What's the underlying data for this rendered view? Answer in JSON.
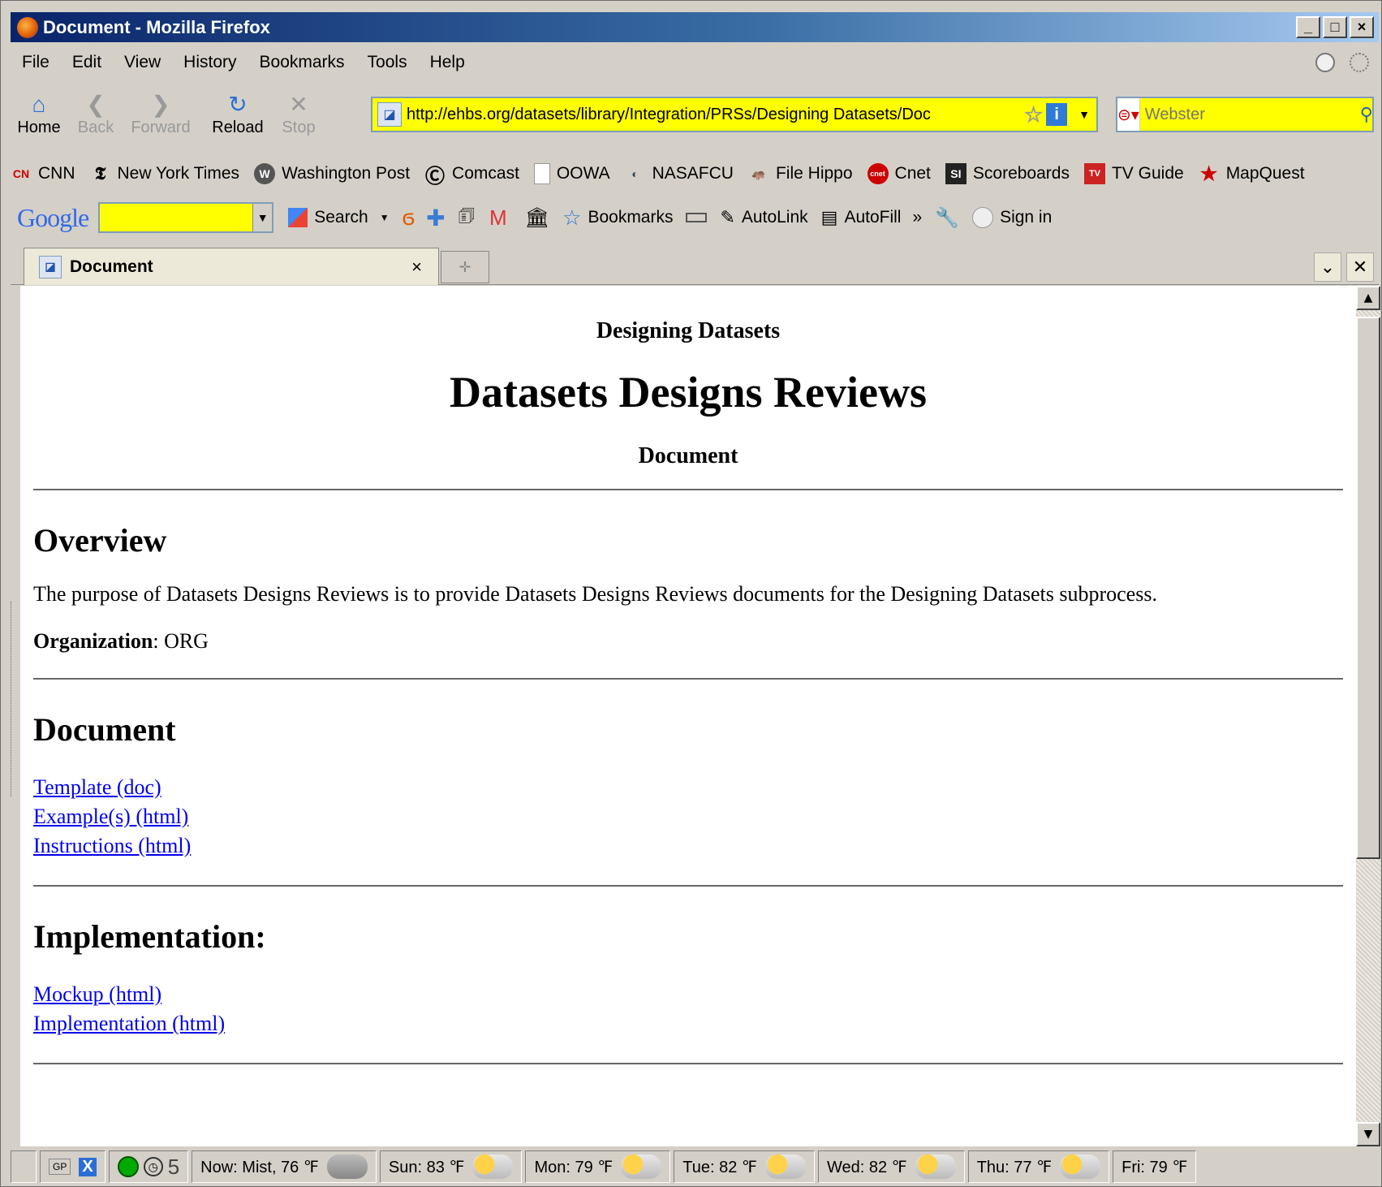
{
  "window": {
    "title": "Document - Mozilla Firefox",
    "min": "_",
    "max": "□",
    "close": "×"
  },
  "menu": [
    "File",
    "Edit",
    "View",
    "History",
    "Bookmarks",
    "Tools",
    "Help"
  ],
  "nav": {
    "home": "Home",
    "back": "Back",
    "forward": "Forward",
    "reload": "Reload",
    "stop": "Stop"
  },
  "url": "http://ehbs.org/datasets/library/Integration/PRSs/Designing Datasets/Doc",
  "search": {
    "placeholder": "Webster"
  },
  "bookmarks": [
    {
      "label": "CNN",
      "icon": "cnn-icon"
    },
    {
      "label": "New York Times",
      "icon": "nyt-icon"
    },
    {
      "label": "Washington Post",
      "icon": "wapo-icon"
    },
    {
      "label": "Comcast",
      "icon": "comcast-icon"
    },
    {
      "label": "OOWA",
      "icon": "page-icon"
    },
    {
      "label": "NASAFCU",
      "icon": "nasafcu-icon"
    },
    {
      "label": "File Hippo",
      "icon": "filehippo-icon"
    },
    {
      "label": "Cnet",
      "icon": "cnet-icon"
    },
    {
      "label": "Scoreboards",
      "icon": "si-icon"
    },
    {
      "label": "TV Guide",
      "icon": "tvguide-icon"
    },
    {
      "label": "MapQuest",
      "icon": "mapquest-icon"
    }
  ],
  "google": {
    "logo": "Google",
    "search": "Search",
    "bookmarks": "Bookmarks",
    "autolink": "AutoLink",
    "autofill": "AutoFill",
    "more": "»",
    "signin": "Sign in"
  },
  "tab": {
    "title": "Document",
    "close": "×"
  },
  "page": {
    "super": "Designing Datasets",
    "title": "Datasets Designs Reviews",
    "subtitle": "Document",
    "overview_heading": "Overview",
    "overview_text": "The purpose of Datasets Designs Reviews is to provide Datasets Designs Reviews documents for the Designing Datasets subprocess.",
    "org_label": "Organization",
    "org_value": ": ORG",
    "document_heading": "Document",
    "document_links": [
      "Template (doc)",
      "Example(s) (html)",
      "Instructions (html)"
    ],
    "impl_heading": "Implementation:",
    "impl_links": [
      "Mockup (html)",
      "Implementation (html)"
    ]
  },
  "status": {
    "gp": "GP",
    "count": "5",
    "weather": [
      "Now: Mist, 76 ℉",
      "Sun: 83 ℉",
      "Mon: 79 ℉",
      "Tue: 82 ℉",
      "Wed: 82 ℉",
      "Thu: 77 ℉",
      "Fri: 79 ℉"
    ]
  }
}
